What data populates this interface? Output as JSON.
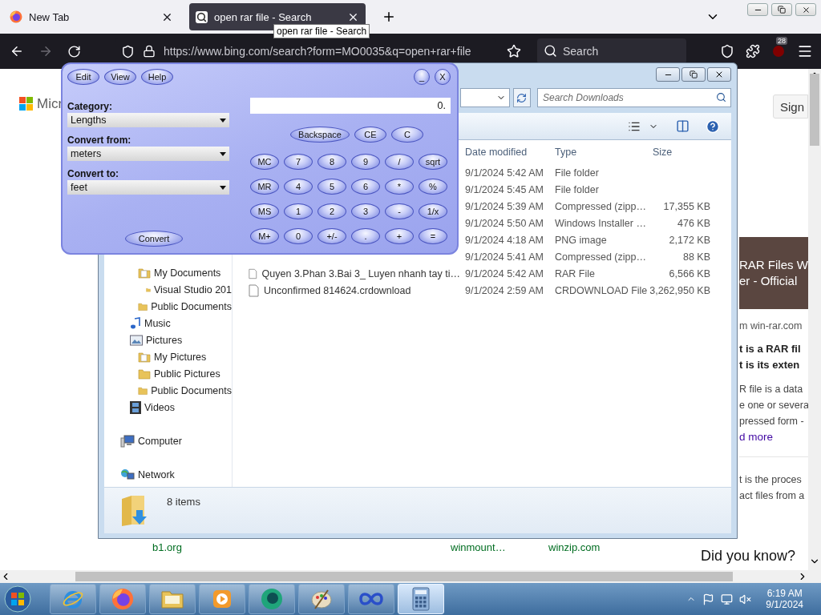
{
  "browser": {
    "tabs": [
      {
        "label": "New Tab",
        "selected": false
      },
      {
        "label": "open rar file - Search",
        "selected": true
      }
    ],
    "tooltip": "open rar file - Search",
    "nav_buttons": [
      {
        "kind": "back",
        "disabled": false
      },
      {
        "kind": "forward",
        "disabled": true
      },
      {
        "kind": "reload",
        "disabled": false
      }
    ],
    "url": "https://www.bing.com/search?form=MO0035&q=open+rar+file",
    "search": {
      "placeholder": "Search"
    },
    "extension_badge": "28",
    "page": {
      "logo_text": "Micr",
      "sign_in": "Sign",
      "banner": [
        "RAR Files W",
        "er - Official"
      ],
      "source": "m win-rar.com",
      "heading": [
        "t is a RAR fil",
        "t is its exten"
      ],
      "snippet": [
        "R file is a data",
        "e one or severa",
        "pressed form -"
      ],
      "read_more": "d more",
      "snippet2": [
        "t is the proces",
        "act files from a"
      ],
      "related": [
        "b1.org",
        "winmount…",
        "winzip.com"
      ],
      "did_you_know": "Did you know?"
    }
  },
  "explorer": {
    "search": {
      "placeholder": "Search Downloads"
    },
    "columns": [
      "Date modified",
      "Type",
      "Size"
    ],
    "files": [
      {
        "date": "9/1/2024 5:42 AM",
        "type": "File folder"
      },
      {
        "date": "9/1/2024 5:45 AM",
        "type": "File folder"
      },
      {
        "date": "9/1/2024 5:39 AM",
        "type": "Compressed (zipp…",
        "size": "17,355 KB"
      },
      {
        "date": "9/1/2024 5:50 AM",
        "type": "Windows Installer …",
        "size": "476 KB"
      },
      {
        "date": "9/1/2024 4:18 AM",
        "type": "PNG image",
        "size": "2,172 KB"
      },
      {
        "date": "9/1/2024 5:41 AM",
        "type": "Compressed (zipp…",
        "size": "88 KB"
      },
      {
        "name": "Quyen 3.Phan 3.Bai 3_ Luyen nhanh tay ti…",
        "date": "9/1/2024 5:42 AM",
        "type": "RAR File",
        "size": "6,566 KB"
      },
      {
        "name": "Unconfirmed 814624.crdownload",
        "date": "9/1/2024 2:59 AM",
        "type": "CRDOWNLOAD File",
        "size": "3,262,950 KB"
      }
    ],
    "nav": [
      {
        "children": [
          {
            "label": "My Documents",
            "kind": "documents",
            "children": [
              {
                "label": "Visual Studio 201",
                "kind": "folder"
              }
            ]
          },
          {
            "label": "Public Documents",
            "kind": "folder"
          }
        ]
      },
      {
        "label": "Music",
        "kind": "music"
      },
      {
        "label": "Pictures",
        "kind": "pictures",
        "children": [
          {
            "label": "My Pictures",
            "kind": "documents"
          },
          {
            "label": "Public Pictures",
            "kind": "folder"
          },
          {
            "label": "Public Documents",
            "kind": "folder"
          }
        ]
      },
      {
        "label": "Videos",
        "kind": "videos"
      }
    ],
    "places": [
      {
        "label": "Computer",
        "kind": "computer"
      },
      {
        "label": "Network",
        "kind": "network"
      }
    ],
    "status": "8 items"
  },
  "calculator": {
    "menu": [
      "Edit",
      "View",
      "Help"
    ],
    "window_buttons": [
      "_",
      "X"
    ],
    "fields": [
      {
        "label": "Category:",
        "value": "Lengths"
      },
      {
        "label": "Convert from:",
        "value": "meters"
      },
      {
        "label": "Convert to:",
        "value": "feet"
      }
    ],
    "convert": "Convert",
    "display": "0.",
    "top_keys": [
      "Backspace",
      "CE",
      "C"
    ],
    "keys": [
      [
        "MC",
        "7",
        "8",
        "9",
        "/",
        "sqrt"
      ],
      [
        "MR",
        "4",
        "5",
        "6",
        "*",
        "%"
      ],
      [
        "MS",
        "1",
        "2",
        "3",
        "-",
        "1/x"
      ],
      [
        "M+",
        "0",
        "+/-",
        ".",
        "+",
        "="
      ]
    ]
  },
  "taskbar": {
    "apps": [
      {
        "kind": "ie",
        "active": false
      },
      {
        "kind": "firefox",
        "active": false
      },
      {
        "kind": "explorer",
        "active": false
      },
      {
        "kind": "media",
        "active": false
      },
      {
        "kind": "globe",
        "active": false
      },
      {
        "kind": "paint",
        "active": false
      },
      {
        "kind": "infinity",
        "active": false
      },
      {
        "kind": "calculator",
        "active": true
      }
    ],
    "time": "6:19 AM",
    "date": "9/1/2024"
  }
}
